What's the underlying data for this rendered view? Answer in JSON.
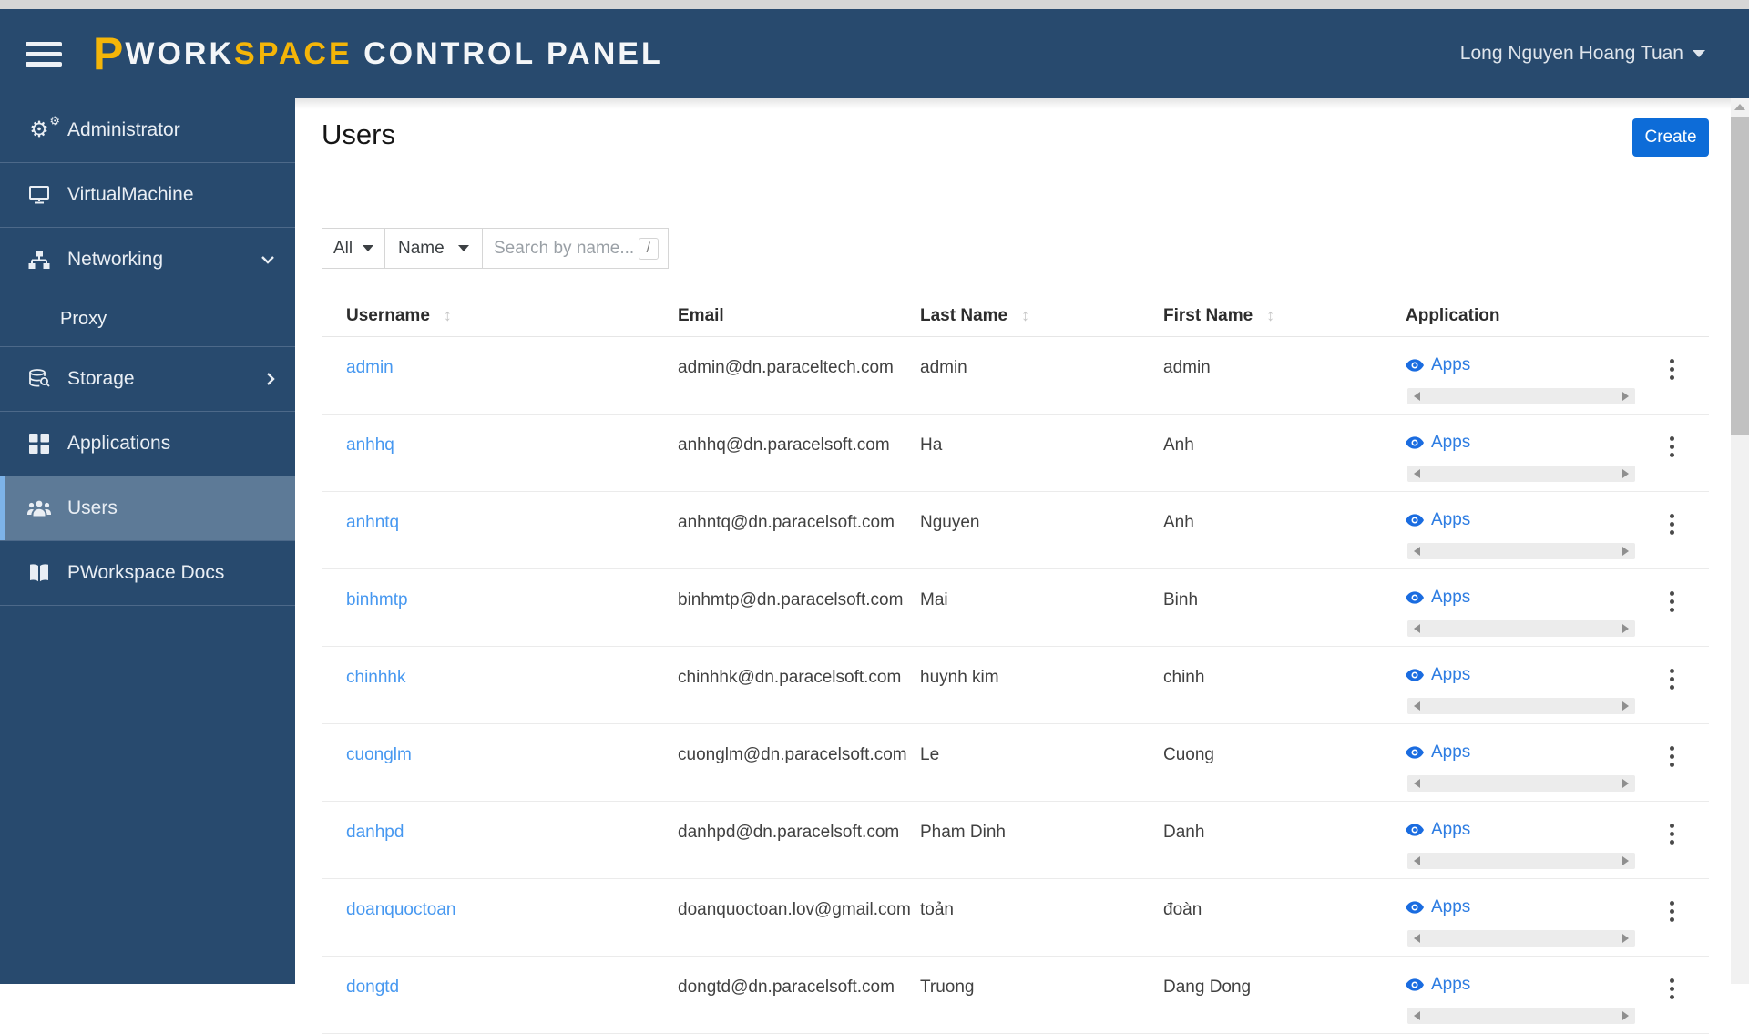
{
  "colors": {
    "navy": "#284a6e",
    "accent_yellow": "#f4b508",
    "active_item_bg": "#5d7a97",
    "active_item_border": "#7db3e8",
    "username_link_blue": "#4798f0",
    "apps_link_blue": "#2e7de2",
    "create_button_blue": "#0d6cd8"
  },
  "header": {
    "logo_p": "P",
    "logo_work": "WORK",
    "logo_space": "SPACE",
    "logo_rest": "CONTROL PANEL",
    "user_name": "Long Nguyen Hoang Tuan"
  },
  "icons": {
    "hamburger": "menu-bars",
    "sort": "up-down-arrows",
    "eye": "eye",
    "kebab": "three-vertical-dots",
    "caret": "caret-down"
  },
  "sidebar": {
    "items": [
      {
        "label": "Administrator",
        "icon": "cogs-icon"
      },
      {
        "label": "VirtualMachine",
        "icon": "virtual-machine-icon"
      },
      {
        "label": "Networking",
        "icon": "network-icon",
        "expanded": true
      },
      {
        "label": "Storage",
        "icon": "storage-icon",
        "collapsed": true
      },
      {
        "label": "Applications",
        "icon": "applications-icon"
      },
      {
        "label": "Users",
        "icon": "users-icon",
        "active": true
      },
      {
        "label": "PWorkspace Docs",
        "icon": "docs-icon"
      }
    ],
    "networking_children": [
      {
        "label": "Proxy"
      }
    ]
  },
  "page": {
    "title": "Users",
    "create_button": "Create"
  },
  "filters": {
    "scope_value": "All",
    "field_value": "Name",
    "search_placeholder": "Search by name...",
    "search_value": "",
    "shortcut_key": "/"
  },
  "table": {
    "columns": [
      {
        "label": "Username",
        "sortable": true
      },
      {
        "label": "Email",
        "sortable": false
      },
      {
        "label": "Last Name",
        "sortable": true
      },
      {
        "label": "First Name",
        "sortable": true
      },
      {
        "label": "Application",
        "sortable": false
      }
    ],
    "apps_link_label": "Apps",
    "rows": [
      {
        "username": "admin",
        "email": "admin@dn.paraceltech.com",
        "last_name": "admin",
        "first_name": "admin"
      },
      {
        "username": "anhhq",
        "email": "anhhq@dn.paracelsoft.com",
        "last_name": "Ha",
        "first_name": "Anh"
      },
      {
        "username": "anhntq",
        "email": "anhntq@dn.paracelsoft.com",
        "last_name": "Nguyen",
        "first_name": "Anh"
      },
      {
        "username": "binhmtp",
        "email": "binhmtp@dn.paracelsoft.com",
        "last_name": "Mai",
        "first_name": "Binh"
      },
      {
        "username": "chinhhk",
        "email": "chinhhk@dn.paracelsoft.com",
        "last_name": "huynh kim",
        "first_name": "chinh"
      },
      {
        "username": "cuonglm",
        "email": "cuonglm@dn.paracelsoft.com",
        "last_name": "Le",
        "first_name": "Cuong"
      },
      {
        "username": "danhpd",
        "email": "danhpd@dn.paracelsoft.com",
        "last_name": "Pham Dinh",
        "first_name": "Danh"
      },
      {
        "username": "doanquoctoan",
        "email": "doanquoctoan.lov@gmail.com",
        "last_name": "toản",
        "first_name": "đoàn"
      },
      {
        "username": "dongtd",
        "email": "dongtd@dn.paracelsoft.com",
        "last_name": "Truong",
        "first_name": "Dang Dong"
      }
    ]
  }
}
